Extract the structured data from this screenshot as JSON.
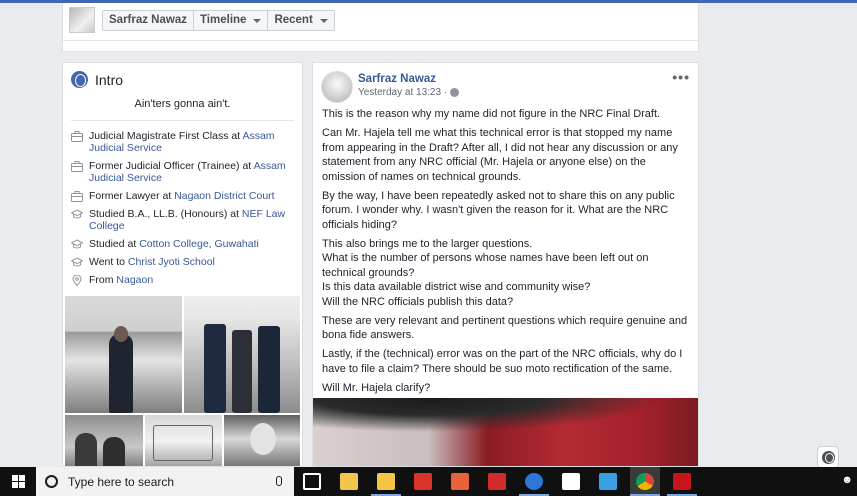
{
  "header": {
    "profile_name": "Sarfraz Nawaz",
    "timeline_label": "Timeline",
    "recent_label": "Recent"
  },
  "intro": {
    "title": "Intro",
    "bio": "Ain'ters gonna ain't.",
    "items": [
      {
        "icon": "briefcase-icon",
        "text": "Judicial Magistrate First Class at ",
        "link": "Assam Judicial Service"
      },
      {
        "icon": "briefcase-icon",
        "text": "Former Judicial Officer (Trainee) at ",
        "link": "Assam Judicial Service"
      },
      {
        "icon": "briefcase-icon",
        "text": "Former Lawyer at ",
        "link": "Nagaon District Court"
      },
      {
        "icon": "graduation-cap-icon",
        "text": "Studied B.A., LL.B. (Honours) at ",
        "link": "NEF Law College"
      },
      {
        "icon": "graduation-cap-icon",
        "text": "Studied at ",
        "link": "Cotton College, Guwahati"
      },
      {
        "icon": "graduation-cap-icon",
        "text": "Went to ",
        "link": "Christ Jyoti School"
      },
      {
        "icon": "location-pin-icon",
        "text": "From ",
        "link": "Nagaon"
      }
    ]
  },
  "post": {
    "author": "Sarfraz Nawaz",
    "timestamp": "Yesterday at 13:23",
    "separator": "·",
    "more": "•••",
    "paragraphs": [
      [
        "This is the reason why my name did not figure in the NRC Final Draft."
      ],
      [
        "Can Mr. Hajela tell me what this technical error is that stopped my name from appearing in the Draft? After all, I did not hear any discussion or any statement from any NRC official (Mr. Hajela or anyone else) on the omission of names on technical grounds."
      ],
      [
        "By the way, I have been repeatedly asked not to share this on any public forum. I wonder why. I wasn't given the reason for it. What are the NRC officials hiding?"
      ],
      [
        "This also brings me to the larger questions.",
        "What is the number of persons whose names have been left out on technical grounds?",
        "Is this data available district wise and community wise?",
        "Will the NRC officials publish this data?"
      ],
      [
        "These are very relevant and pertinent questions which require genuine and bona fide answers."
      ],
      [
        "Lastly, if the (technical) error was on the part of the NRC officials, why do I have to file a claim? There should be suo moto rectification of the same."
      ],
      [
        "Will Mr. Hajela clarify?"
      ]
    ]
  },
  "taskbar": {
    "search_placeholder": "Type here to search",
    "apps": [
      "task-view",
      "store",
      "file-explorer",
      "red-app",
      "orange-app",
      "red-cube-app",
      "edge",
      "mail",
      "blue-app",
      "chrome",
      "acrobat"
    ]
  },
  "colors": {
    "facebook_blue": "#4267b2",
    "link_blue": "#385898",
    "taskbar_bg": "#101010"
  }
}
